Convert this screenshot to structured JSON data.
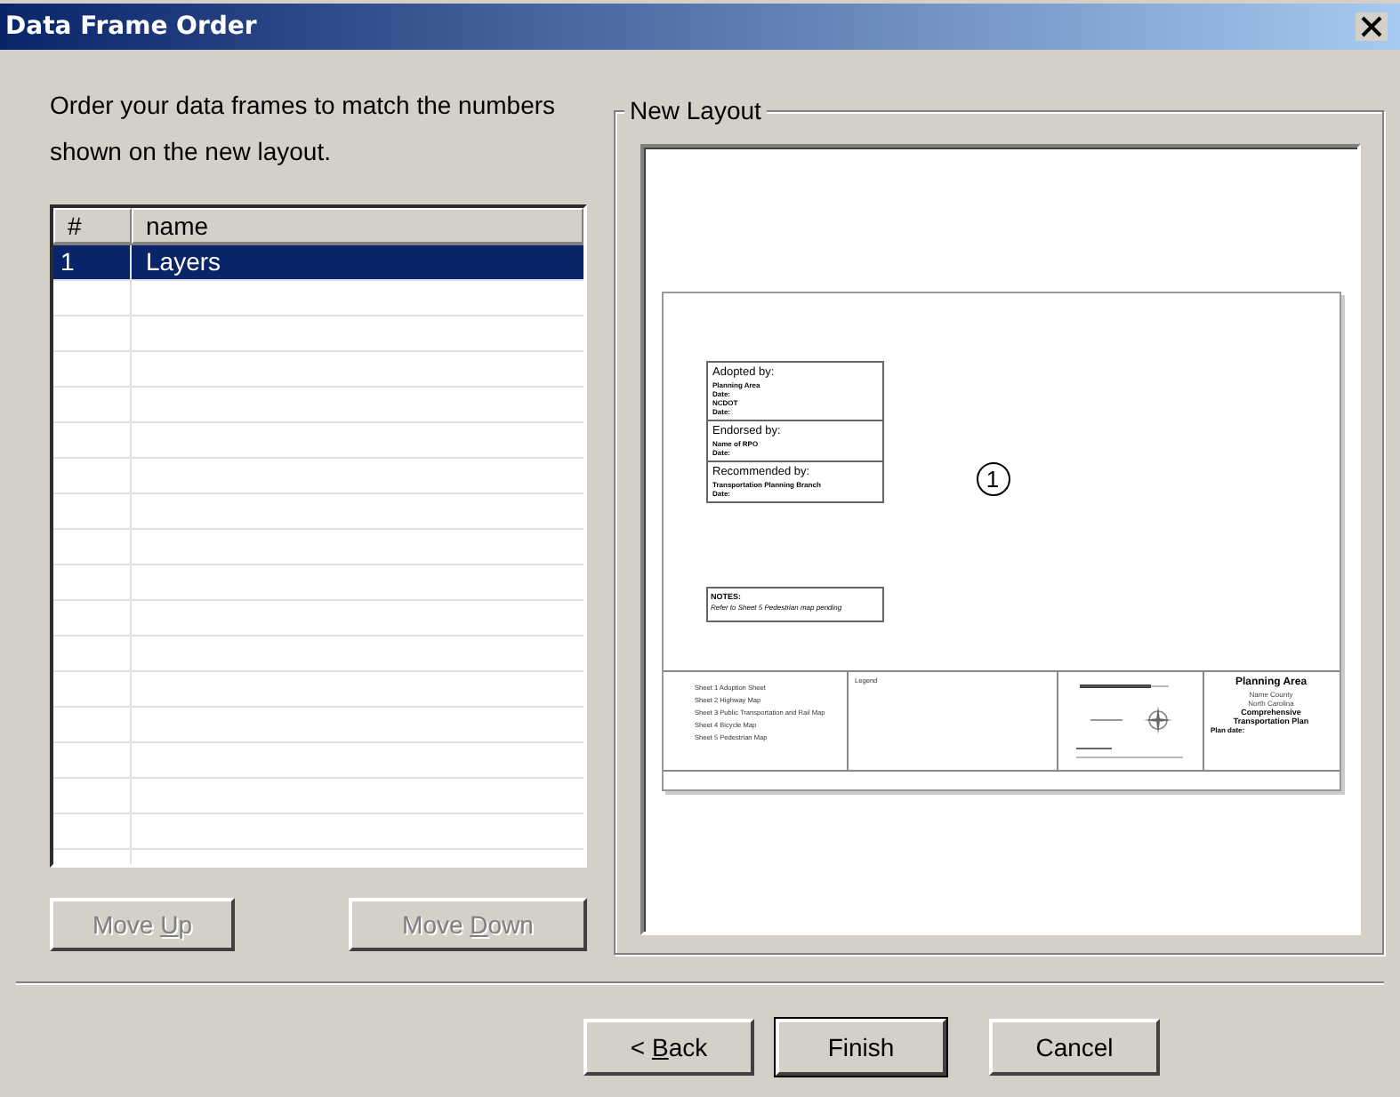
{
  "window": {
    "title": "Data Frame Order"
  },
  "instructions": "Order your data frames to match the numbers shown on the new layout.",
  "frame_list": {
    "columns": [
      "#",
      "name"
    ],
    "rows": [
      {
        "number": "1",
        "name": "Layers",
        "selected": true
      }
    ]
  },
  "list_buttons": [
    {
      "parts": [
        "Move ",
        "U",
        "p"
      ],
      "disabled": true
    },
    {
      "parts": [
        "Move ",
        "D",
        "own"
      ],
      "disabled": true
    }
  ],
  "layout_group": {
    "title": "New Layout",
    "frame_number": "1",
    "approval_box": [
      {
        "heading": "Adopted by:",
        "lines": [
          "Planning Area",
          "Date:",
          "NCDOT",
          "Date:"
        ]
      },
      {
        "heading": "Endorsed by:",
        "lines": [
          "Name of RPO",
          "Date:"
        ]
      },
      {
        "heading": "Recommended by:",
        "lines": [
          "Transportation Planning Branch",
          "Date:"
        ]
      }
    ],
    "notes": {
      "heading": "NOTES:",
      "text": "Refer to Sheet 5 Pedestrian map pending"
    },
    "sheets": [
      "Sheet 1 Adoption Sheet",
      "Sheet 2 Highway Map",
      "Sheet 3 Public Transportation and Rail Map",
      "Sheet 4 Bicycle Map",
      "Sheet 5 Pedestrian Map"
    ],
    "legend": "Legend",
    "title_block": [
      "Planning Area",
      "Name County",
      "North Carolina",
      "Comprehensive",
      "Transportation Plan",
      "Plan date:"
    ]
  },
  "buttons": [
    {
      "parts": [
        "< ",
        "B",
        "ack"
      ]
    },
    {
      "parts": [
        "Finish"
      ]
    },
    {
      "parts": [
        "Cancel"
      ]
    }
  ]
}
